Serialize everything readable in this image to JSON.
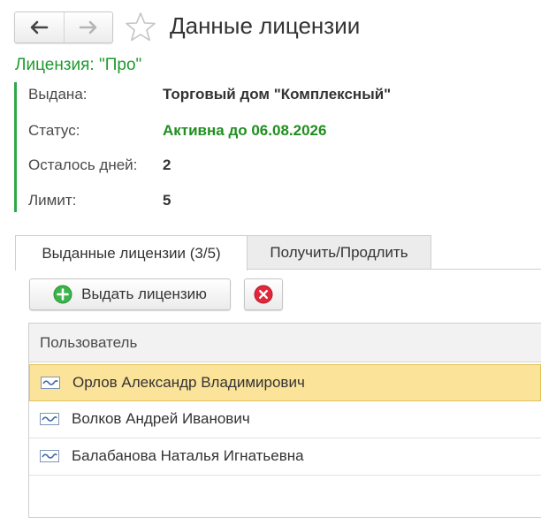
{
  "window": {
    "title": "Данные лицензии",
    "back_icon": "arrow-left-icon",
    "forward_icon": "arrow-right-icon",
    "favorite_icon": "star-outline-icon"
  },
  "license": {
    "header": "Лицензия: \"Про\"",
    "fields": [
      {
        "label": "Выдана:",
        "value": "Торговый дом \"Комплексный\""
      },
      {
        "label": "Статус:",
        "value": "Активна до 06.08.2026"
      },
      {
        "label": "Осталось дней:",
        "value": "2"
      },
      {
        "label": "Лимит:",
        "value": "5"
      }
    ]
  },
  "tabs": [
    {
      "label": "Выданные лицензии (3/5)",
      "active": true
    },
    {
      "label": "Получить/Продлить",
      "active": false
    }
  ],
  "toolbar": {
    "issue_label": "Выдать лицензию",
    "issue_icon": "plus-circle-icon",
    "delete_icon": "close-circle-icon"
  },
  "table": {
    "column": "Пользователь",
    "rows": [
      {
        "name": "Орлов Александр Владимирович",
        "selected": true
      },
      {
        "name": "Волков Андрей Иванович",
        "selected": false
      },
      {
        "name": "Балабанова Наталья Игнатьевна",
        "selected": false
      }
    ]
  },
  "colors": {
    "accent_green": "#1f9a2d",
    "selection": "#fbe39a"
  }
}
